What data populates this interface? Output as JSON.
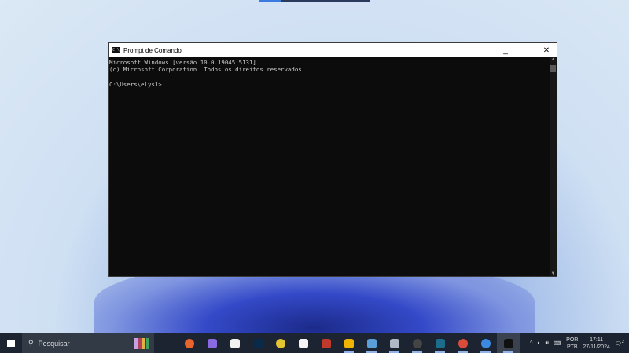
{
  "window": {
    "title": "Prompt de Comando",
    "minimize": "_",
    "close": "✕",
    "lines": [
      "Microsoft Windows [versão 10.0.19045.5131]",
      "(c) Microsoft Corporation. Todos os direitos reservados.",
      "",
      "C:\\Users\\elys1>"
    ]
  },
  "taskbar": {
    "search_placeholder": "Pesquisar",
    "apps": [
      {
        "name": "firefox",
        "color": "#e8642c"
      },
      {
        "name": "copilot",
        "color": "#8a6ae0"
      },
      {
        "name": "microsoft-store",
        "color": "#f2f2f2"
      },
      {
        "name": "photoshop",
        "color": "#0a2a4a"
      },
      {
        "name": "chrome",
        "color": "#e2c530"
      },
      {
        "name": "capcut",
        "color": "#f5f5f5"
      },
      {
        "name": "app-red",
        "color": "#c0392b"
      },
      {
        "name": "file-explorer",
        "color": "#f0b400"
      },
      {
        "name": "notepad",
        "color": "#5aa0d8"
      },
      {
        "name": "paint",
        "color": "#b0b8c8"
      },
      {
        "name": "obs",
        "color": "#444"
      },
      {
        "name": "visual-studio",
        "color": "#1c6d8c"
      },
      {
        "name": "chrome-profile-1",
        "color": "#d94c3a"
      },
      {
        "name": "chrome-profile-2",
        "color": "#3b8ae0"
      },
      {
        "name": "command-prompt",
        "color": "#111"
      }
    ],
    "tray": {
      "lang_top": "POR",
      "lang_bottom": "PTB",
      "time": "17:11",
      "date": "27/11/2024",
      "notifications": "2"
    }
  }
}
